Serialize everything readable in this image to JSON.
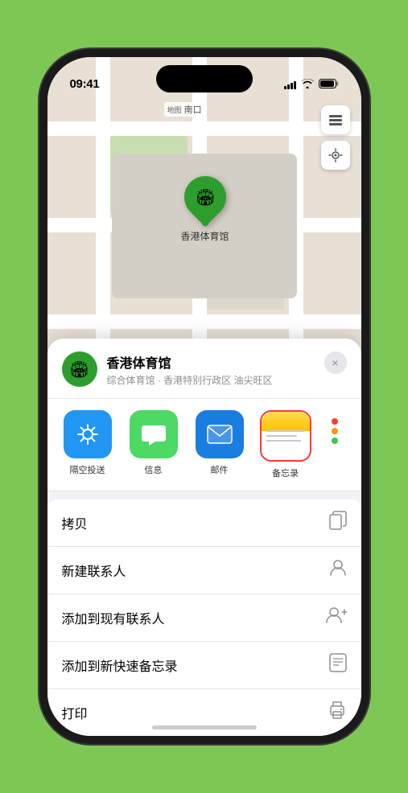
{
  "status_bar": {
    "time": "09:41",
    "time_with_arrow": "09:41 ▶"
  },
  "map": {
    "label": "南口",
    "pin_name": "香港体育馆"
  },
  "location_header": {
    "name": "香港体育馆",
    "subtitle": "综合体育馆 · 香港特别行政区 油尖旺区",
    "close_label": "×"
  },
  "share_items": [
    {
      "id": "airdrop",
      "label": "隔空投送",
      "type": "airdrop"
    },
    {
      "id": "messages",
      "label": "信息",
      "type": "messages"
    },
    {
      "id": "mail",
      "label": "邮件",
      "type": "mail"
    },
    {
      "id": "notes",
      "label": "备忘录",
      "type": "notes",
      "selected": true
    }
  ],
  "more_colors": [
    "#ff3b30",
    "#ff9500",
    "#34c759"
  ],
  "action_items": [
    {
      "id": "copy",
      "label": "拷贝",
      "icon": "copy"
    },
    {
      "id": "new-contact",
      "label": "新建联系人",
      "icon": "person"
    },
    {
      "id": "add-contact",
      "label": "添加到现有联系人",
      "icon": "person-add"
    },
    {
      "id": "quick-note",
      "label": "添加到新快速备忘录",
      "icon": "note"
    },
    {
      "id": "print",
      "label": "打印",
      "icon": "printer"
    }
  ]
}
